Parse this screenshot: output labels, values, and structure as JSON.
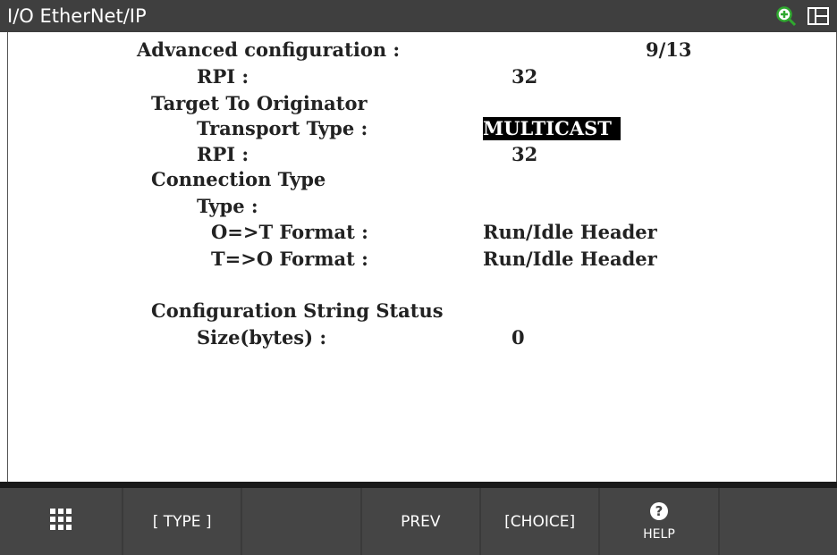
{
  "titlebar": {
    "title": "I/O EtherNet/IP",
    "icons": [
      "zoom-in-icon",
      "split-screen-icon"
    ],
    "zoom_icon_color": "#2fa82f"
  },
  "screen": {
    "heading": "Advanced configuration :",
    "page_indicator": "9/13",
    "rpi1_label": "RPI :",
    "rpi1_value": "32",
    "t2o_heading": "Target To Originator",
    "transport_label": "Transport Type :",
    "transport_value": "MULTICAST",
    "rpi2_label": "RPI :",
    "rpi2_value": "32",
    "conn_heading": "Connection Type",
    "type_label": "Type :",
    "o2t_label": "O=>T Format :",
    "o2t_value": "Run/Idle Header",
    "t2o_label": "T=>O Format :",
    "t2o_value": "Run/Idle Header",
    "cfg_heading": "Configuration String Status",
    "size_label": "Size(bytes) :",
    "size_value": "0"
  },
  "function_keys": {
    "f1_icon": "menu-grid-icon",
    "f2": "[ TYPE ]",
    "f3": "",
    "f4": "PREV",
    "f5": "[CHOICE]",
    "f6": "HELP",
    "f6_icon": "help-icon",
    "f7": ""
  }
}
